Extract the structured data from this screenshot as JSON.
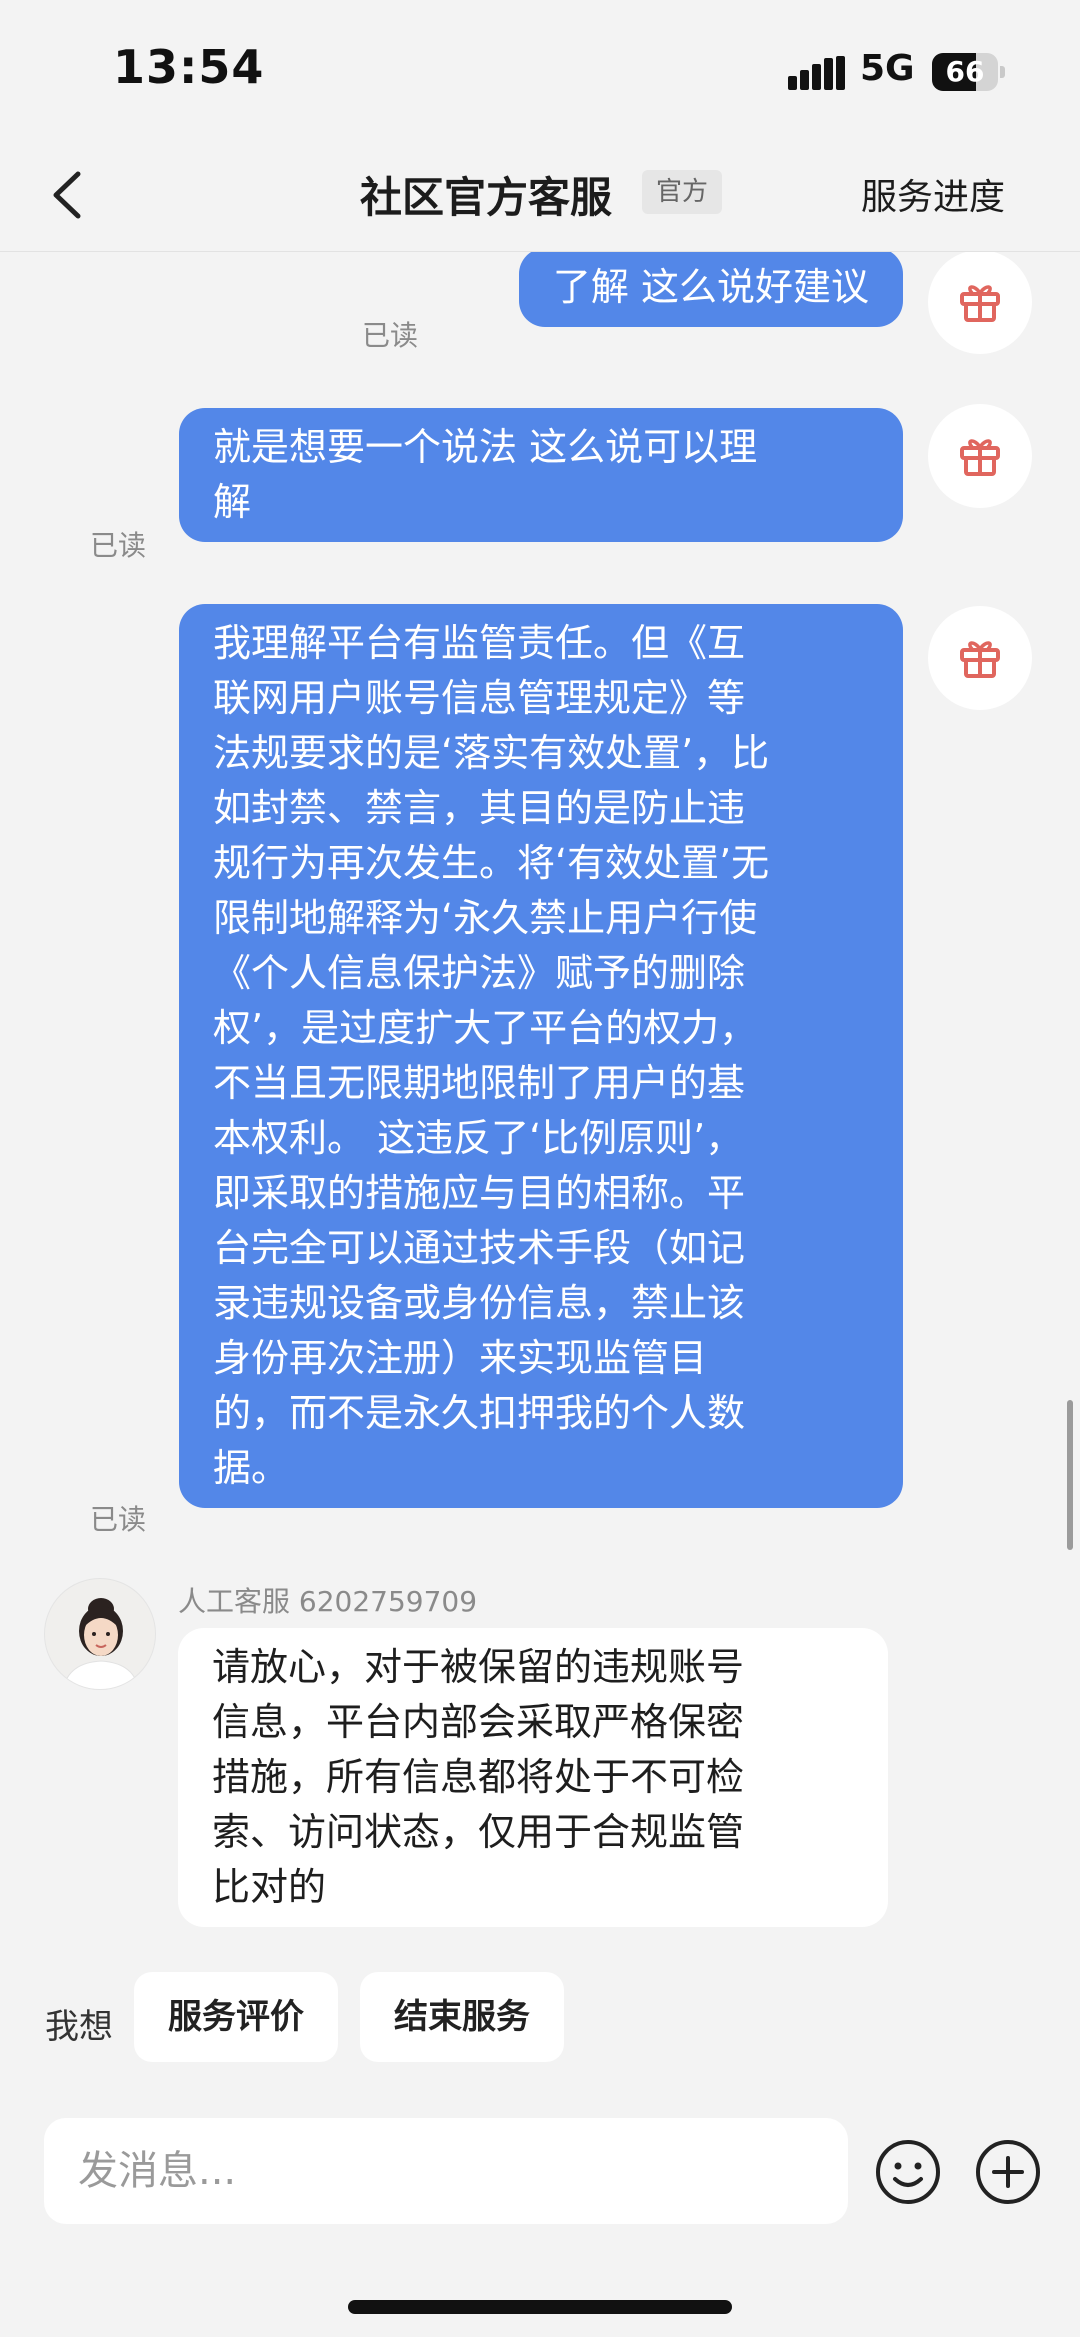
{
  "status_bar": {
    "time": "13:54",
    "network": "5G",
    "battery": "66",
    "battery_level": 0.66
  },
  "header": {
    "title": "社区官方客服",
    "badge": "官方",
    "right_action": "服务进度"
  },
  "messages": {
    "m1": {
      "text": "了解  这么说好建议",
      "status": "已读"
    },
    "m2": {
      "text": "就是想要一个说法  这么说可以理\n解",
      "status": "已读"
    },
    "m3": {
      "text": "我理解平台有监管责任。但《互\n联网用户账号信息管理规定》等\n法规要求的是‘落实有效处置’，比\n如封禁、禁言，其目的是防止违\n规行为再次发生。将‘有效处置’无\n限制地解释为‘永久禁止用户行使\n《个人信息保护法》赋予的删除\n权’，是过度扩大了平台的权力，\n不当且无限期地限制了用户的基\n本权利。 这违反了‘比例原则’，\n即采取的措施应与目的相称。平\n台完全可以通过技术手段（如记\n录违规设备或身份信息，禁止该\n身份再次注册）来实现监管目\n的，而不是永久扣押我的个人数\n据。",
      "status": "已读"
    },
    "m4": {
      "sender": "人工客服 6202759709",
      "text": " 请放心，对于被保留的违规账号\n信息，平台内部会采取严格保密\n措施，所有信息都将处于不可检\n索、访问状态，仅用于合规监管\n比对的"
    }
  },
  "quick_actions": {
    "label": "我想",
    "items": [
      "服务评价",
      "结束服务"
    ]
  },
  "input": {
    "placeholder": "发消息..."
  },
  "colors": {
    "outgoing_bubble": "#5387e8",
    "incoming_bubble": "#ffffff",
    "background": "#f3f3f3",
    "gift_icon": "#e0665e"
  }
}
